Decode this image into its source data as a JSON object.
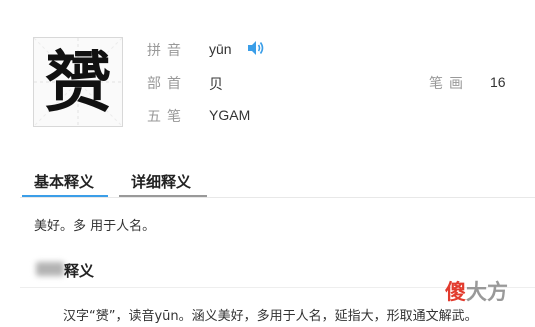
{
  "character": {
    "glyph": "赟"
  },
  "info": {
    "pinyin_label": "拼音",
    "pinyin_value": "yūn",
    "radical_label": "部首",
    "radical_value": "贝",
    "wubi_label": "五笔",
    "wubi_value": "YGAM",
    "strokes_label": "笔画",
    "strokes_value": "16"
  },
  "tabs": [
    {
      "label": "基本释义",
      "active": true
    },
    {
      "label": "详细释义",
      "active": false
    }
  ],
  "basic_definition": "美好。多 用于人名。",
  "section": {
    "title": "释义",
    "body": "汉字“赟”，读音yūn。涵义美好，多用于人名，延指大，形取通文解武。"
  },
  "watermark": {
    "part1": "傻",
    "part2": "大方"
  },
  "colors": {
    "speaker": "#3b9ee8",
    "tab_active_underline": "#3b9ee8",
    "tab_inactive_underline": "#999999",
    "watermark_red": "#e23b2e"
  }
}
